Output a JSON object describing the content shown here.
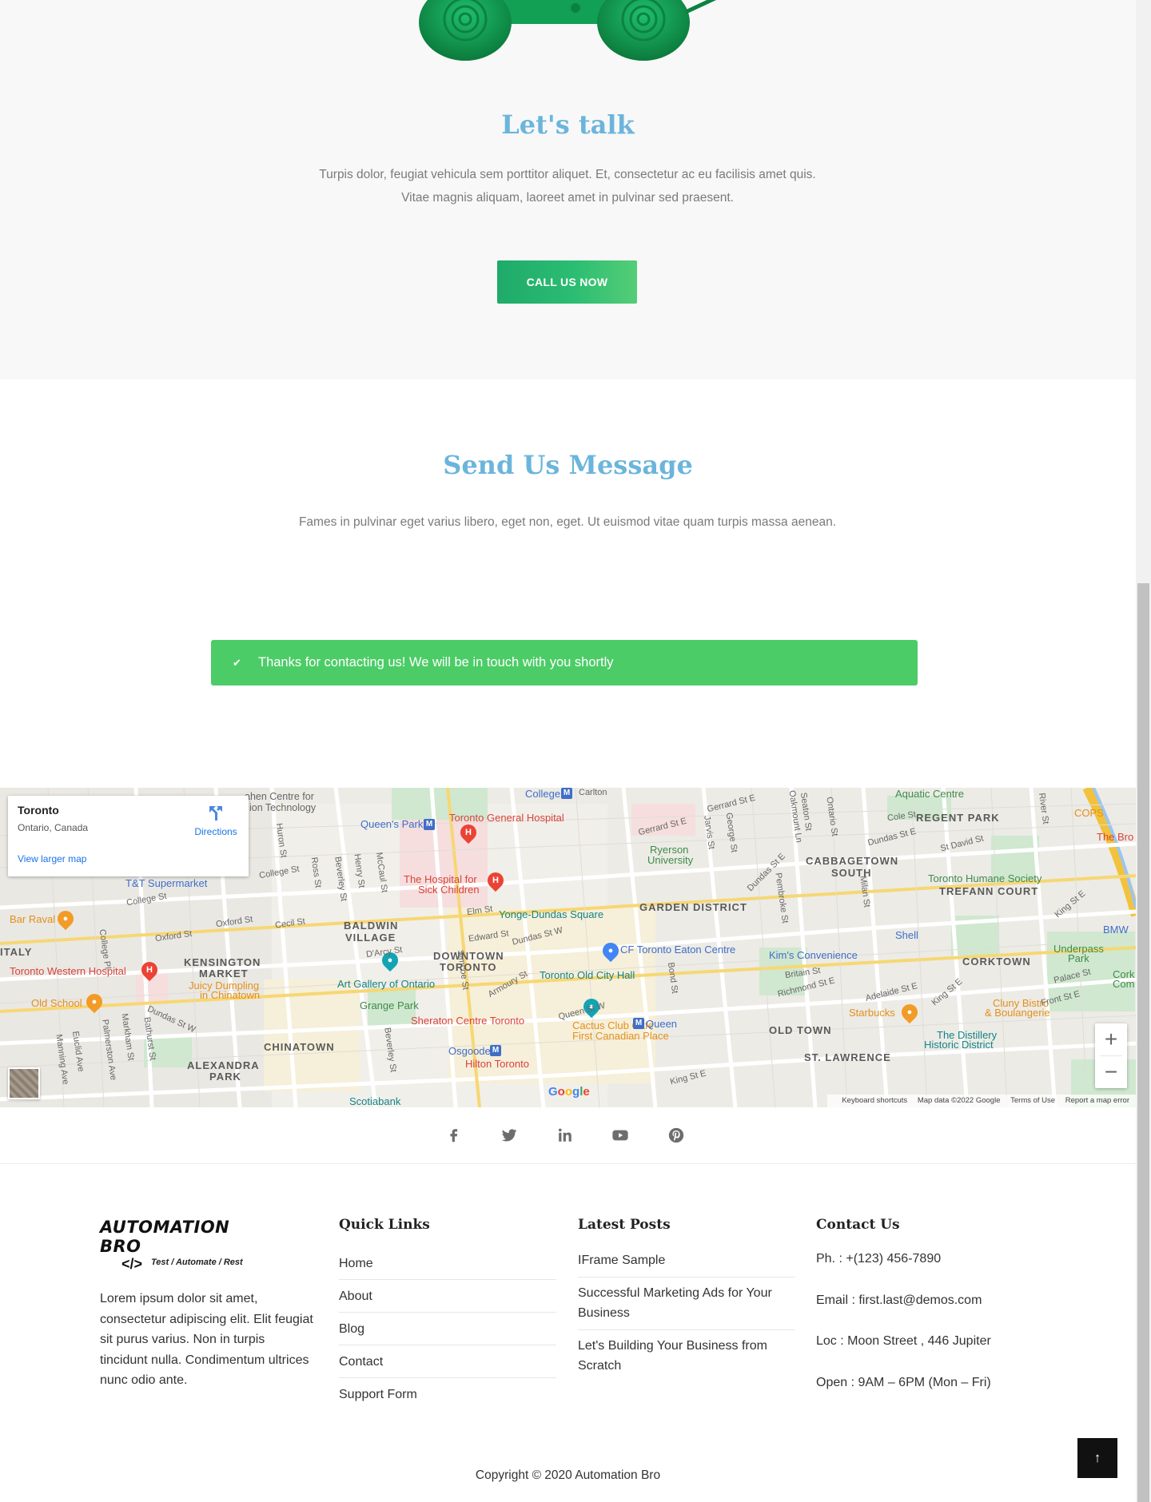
{
  "talk": {
    "title": "Let's talk",
    "text": "Turpis dolor, feugiat vehicula sem porttitor aliquet. Et, consectetur ac eu facilisis amet quis. Vitae magnis aliquam, laoreet amet in pulvinar sed praesent.",
    "cta_label": "CALL US NOW"
  },
  "message": {
    "title": "Send Us Message",
    "text": "Fames in pulvinar eget varius libero, eget non, eget. Ut euismod vitae quam turpis massa aenean.",
    "alert": "Thanks for contacting us! We will be in touch with you shortly"
  },
  "map": {
    "card_city": "Toronto",
    "card_region": "Ontario, Canada",
    "directions_label": "Directions",
    "larger_map_label": "View larger map",
    "attribution": [
      "Keyboard shortcuts",
      "Map data ©2022 Google",
      "Terms of Use",
      "Report a map error"
    ],
    "logo": "Google",
    "labels": {
      "regent_park": "REGENT PARK",
      "cabbagetown": "CABBAGETOWN",
      "cabbagetown_south": "SOUTH",
      "trefann": "TREFANN COURT",
      "garden_district": "GARDEN DISTRICT",
      "baldwin": "BALDWIN",
      "baldwin2": "VILLAGE",
      "downtown": "DOWNTOWN",
      "downtown2": "TORONTO",
      "kensington": "KENSINGTON",
      "kensington2": "MARKET",
      "chinatown": "CHINATOWN",
      "alexandra": "ALEXANDRA",
      "alexandra2": "PARK",
      "corktown": "CORKTOWN",
      "old_town": "OLD TOWN",
      "st_lawrence": "ST. LAWRENCE",
      "little_italy": "ITALY",
      "toronto_general": "Toronto General Hospital",
      "sick_children": "The Hospital for",
      "sick_children2": "Sick Children",
      "toronto_western": "Toronto Western Hospital",
      "sheraton": "Sheraton Centre Toronto",
      "hilton": "Hilton Toronto",
      "yonge_dundas": "Yonge-Dundas Square",
      "eaton": "CF Toronto Eaton Centre",
      "old_city_hall": "Toronto Old City Hall",
      "art_gallery": "Art Gallery of Ontario",
      "grange_park": "Grange Park",
      "kims": "Kim's Convenience",
      "humane": "Toronto Humane Society",
      "distillery": "The Distillery",
      "distillery2": "Historic District",
      "ryerson": "Ryerson",
      "ryerson2": "University",
      "tt": "T&T Supermarket",
      "bar_raval": "Bar Raval",
      "old_school": "Old School",
      "juicy": "Juicy Dumpling",
      "juicy2": "in Chinatown",
      "cactus": "Cactus Club Cafe",
      "cactus2": "First Canadian Place",
      "starbucks": "Starbucks",
      "cluny": "Cluny Bistro",
      "cluny2": "& Boulangerie",
      "shell": "Shell",
      "underpass": "Underpass",
      "underpass2": "Park",
      "aquatic": "Aquatic Centre",
      "cops": "COPS",
      "the_bro": "The Bro",
      "bmw": "BMW",
      "cork": "Cork",
      "cork2": "Com",
      "queens_park": "Queen's Park",
      "college": "College",
      "carlton": "Carlton",
      "queen": "Queen",
      "osgoode": "Osgoode",
      "scotiabank": "Scotiabank",
      "dahlen": "ahen Centre for",
      "dahlen2": "ion Technology",
      "st_college": "College St",
      "st_gerrard": "Gerrard St E",
      "st_gerrard2": "Gerrard St E",
      "st_dundas_w": "Dundas St W",
      "st_dundas_w2": "Dundas St W",
      "st_dundas_e": "Dundas St E",
      "st_dundas_e2": "Dundas St E",
      "st_queen_w": "Queen St W",
      "st_king_e": "King St E",
      "st_king_e2": "King St E",
      "st_king_e3": "King St E",
      "st_richmond": "Richmond St E",
      "st_adelaide": "Adelaide St E",
      "st_jarvis": "Jarvis St",
      "st_bathurst": "Bathurst St",
      "st_beverley": "Beverley St",
      "st_beverley2": "Beverley St",
      "st_elm": "Elm St",
      "st_edward": "Edward St",
      "st_oxford": "Oxford St",
      "st_oxford2": "Oxford St",
      "st_cecil": "Cecil St",
      "st_darcy": "D'Arcy St",
      "st_armoury": "Armoury St",
      "st_simcoe": "Simcoe St",
      "st_bond": "Bond St",
      "st_britain": "Britain St",
      "st_palace": "Palace St",
      "st_front": "Front St E",
      "st_cole": "Cole St",
      "st_st_david": "St David St",
      "st_river": "River St",
      "st_huron": "Huron St",
      "st_ross": "Ross St",
      "st_mccaul": "McCaul St",
      "st_henry": "Henry St",
      "st_george": "George St",
      "st_seaton": "Seaton St",
      "st_ontario": "Ontario St",
      "st_sherbourne": "Oakmount Ln",
      "st_pembroke": "Pembroke St",
      "st_milan": "Milan St",
      "st_college_pl": "College Pl",
      "st_markham": "Markham St",
      "st_palmerston": "Palmerston Ave",
      "st_manning": "Manning Ave",
      "st_euclid": "Euclid Ave"
    }
  },
  "social": {
    "icons": [
      "facebook-icon",
      "twitter-icon",
      "linkedin-icon",
      "youtube-icon",
      "pinterest-icon"
    ]
  },
  "footer": {
    "brand": "AUTOMATION BRO",
    "tagline": "Test / Automate / Rest",
    "code_glyph": "</>",
    "about": "Lorem ipsum dolor sit amet, consectetur adipiscing elit. Elit feugiat sit purus varius. Non in turpis tincidunt nulla. Condimentum ultrices nunc odio ante.",
    "quick_links_title": "Quick Links",
    "quick_links": [
      "Home",
      "About",
      "Blog",
      "Contact",
      "Support Form"
    ],
    "latest_posts_title": "Latest Posts",
    "latest_posts": [
      "IFrame Sample",
      "Successful Marketing Ads for Your Business",
      "Let's Building Your Business from Scratch"
    ],
    "contact_title": "Contact Us",
    "contact": [
      "Ph. : +(123) 456-7890",
      "Email : first.last@demos.com",
      "Loc : Moon Street , 446 Jupiter",
      "Open : 9AM – 6PM (Mon – Fri)"
    ],
    "copyright": "Copyright © 2020 Automation Bro",
    "to_top_glyph": "↑"
  },
  "colors": {
    "heading": "#6bb5dc",
    "cta_green": "#2bbd72",
    "alert_green": "#4ccc67"
  }
}
